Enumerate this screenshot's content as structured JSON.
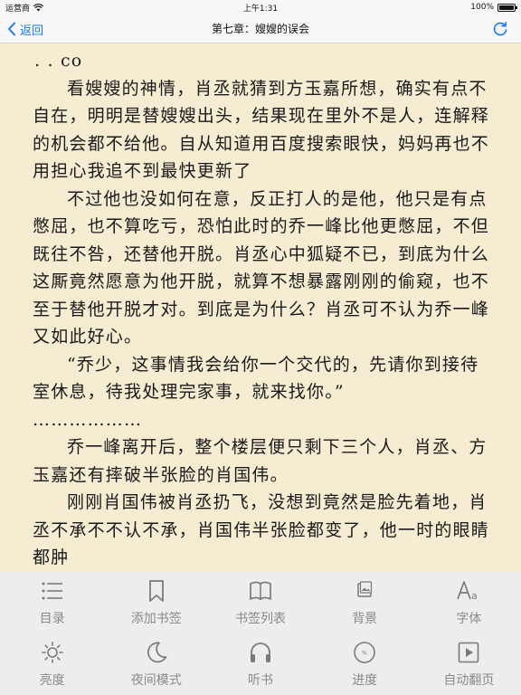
{
  "status_bar": {
    "carrier": "运营商",
    "time": "上午1:31",
    "battery_percent": "100%",
    "battery_level": 1.0
  },
  "nav": {
    "back_label": "返回",
    "title": "第七章：嫂嫂的误会",
    "accent_color": "#1a7cf5"
  },
  "content": {
    "paragraphs": [
      ". . co",
      "看嫂嫂的神情，肖丞就猜到方玉嘉所想，确实有点不自在，明明是替嫂嫂出头，结果现在里外不是人，连解释的机会都不给他。自从知道用百度搜索眼快，妈妈再也不用担心我追不到最快更新了",
      "不过他也没如何在意，反正打人的是他，他只是有点憋屈，也不算吃亏，恐怕此时的乔一峰比他更憋屈，不但既往不咎，还替他开脱。肖丞心中狐疑不已，到底为什么这厮竟然愿意为他开脱，就算不想暴露刚刚的偷窥，也不至于替他开脱才对。到底是为什么？肖丞可不认为乔一峰又如此好心。",
      "“乔少，这事情我会给你一个交代的，先请你到接待室休息，待我处理完家事，就来找你。”",
      "………………",
      "乔一峰离开后，整个楼层便只剩下三个人，肖丞、方玉嘉还有摔破半张脸的肖国伟。",
      "刚刚肖国伟被肖丞扔飞，没想到竟然是脸先着地，肖丞不承不不认不承，肖国伟半张脸都变了，他一时的眼睛都肿"
    ]
  },
  "toolbar": {
    "items": [
      {
        "label": "目录",
        "icon": "list-icon"
      },
      {
        "label": "添加书签",
        "icon": "bookmark-icon"
      },
      {
        "label": "书签列表",
        "icon": "book-icon"
      },
      {
        "label": "背景",
        "icon": "image-icon"
      },
      {
        "label": "字体",
        "icon": "font-icon"
      },
      {
        "label": "亮度",
        "icon": "sun-icon"
      },
      {
        "label": "夜间模式",
        "icon": "moon-icon"
      },
      {
        "label": "听书",
        "icon": "headphones-icon"
      },
      {
        "label": "进度",
        "icon": "progress-icon"
      },
      {
        "label": "自动翻页",
        "icon": "play-icon"
      }
    ]
  }
}
